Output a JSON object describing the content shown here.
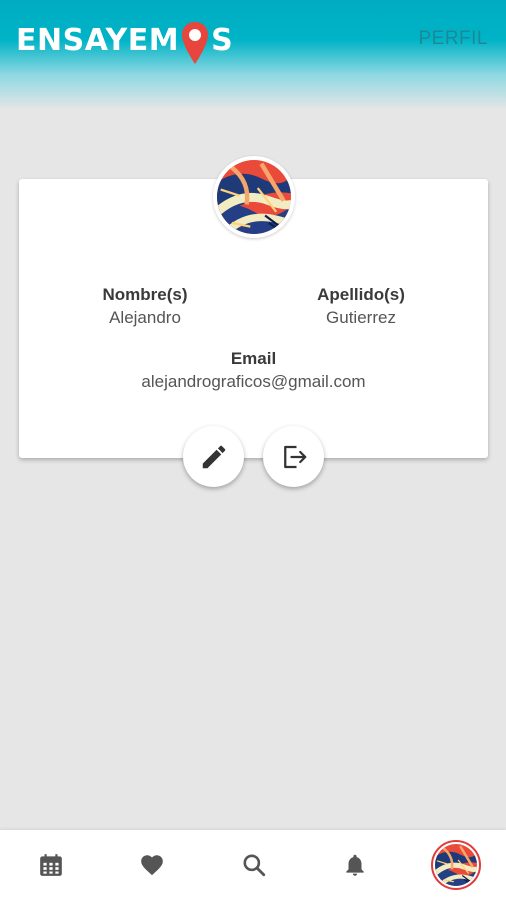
{
  "app": {
    "logo_text_left": "ENSAYEM",
    "logo_text_right": "S",
    "page_title": "PERFIL"
  },
  "profile": {
    "name_label": "Nombre(s)",
    "name_value": "Alejandro",
    "lastname_label": "Apellido(s)",
    "lastname_value": "Gutierrez",
    "email_label": "Email",
    "email_value": "alejandrograficos@gmail.com"
  },
  "actions": {
    "edit_icon": "pencil-icon",
    "logout_icon": "logout-icon"
  },
  "bottom_nav": {
    "items": [
      {
        "icon": "calendar-icon"
      },
      {
        "icon": "heart-icon"
      },
      {
        "icon": "search-icon"
      },
      {
        "icon": "bell-icon"
      },
      {
        "icon": "avatar"
      }
    ]
  },
  "colors": {
    "header_teal": "#00acc1",
    "pin_red": "#e8453c",
    "icon_dark": "#333333",
    "nav_icon": "#555555",
    "background": "#e6e6e6"
  }
}
